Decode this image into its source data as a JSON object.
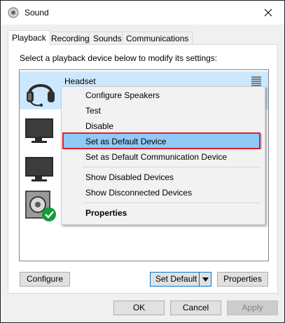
{
  "window": {
    "title": "Sound"
  },
  "tabs": [
    {
      "label": "Playback",
      "active": true
    },
    {
      "label": "Recording",
      "active": false
    },
    {
      "label": "Sounds",
      "active": false
    },
    {
      "label": "Communications",
      "active": false
    }
  ],
  "playback": {
    "instruction": "Select a playback device below to modify its settings:",
    "devices": [
      {
        "name": "Headset",
        "icon": "headset-icon",
        "selected": true
      },
      {
        "name": "",
        "icon": "monitor-icon",
        "selected": false
      },
      {
        "name": "",
        "icon": "monitor-icon",
        "selected": false
      },
      {
        "name": "",
        "icon": "speaker-default-icon",
        "selected": false
      }
    ]
  },
  "context_menu": {
    "items": [
      {
        "label": "Configure Speakers"
      },
      {
        "label": "Test"
      },
      {
        "label": "Disable"
      },
      {
        "label": "Set as Default Device",
        "highlighted": true
      },
      {
        "label": "Set as Default Communication Device"
      },
      {
        "label": "Show Disabled Devices"
      },
      {
        "label": "Show Disconnected Devices"
      },
      {
        "label": "Properties",
        "bold": true
      }
    ]
  },
  "buttons": {
    "configure": "Configure",
    "set_default": "Set Default",
    "properties": "Properties",
    "ok": "OK",
    "cancel": "Cancel",
    "apply": "Apply"
  },
  "colors": {
    "selection": "#cce8ff",
    "menu_highlight": "#91c9f7",
    "annotation_red": "#e0202a",
    "check_green": "#0f9d3a",
    "focus_blue": "#0078d7"
  }
}
